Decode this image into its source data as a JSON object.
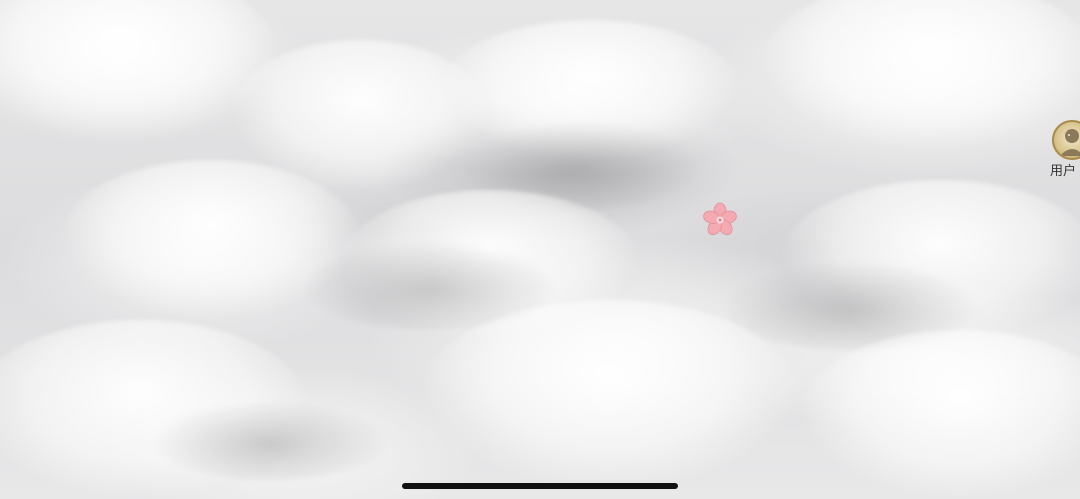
{
  "user_button": {
    "label": "用户",
    "icon": "user-avatar-icon"
  },
  "center_item": {
    "icon": "cherry-blossom-icon",
    "color": "#f2a3ad"
  },
  "background": {
    "theme": "clouds",
    "base_color": "#e4e4e5"
  },
  "system": {
    "home_indicator_color": "#111111"
  }
}
